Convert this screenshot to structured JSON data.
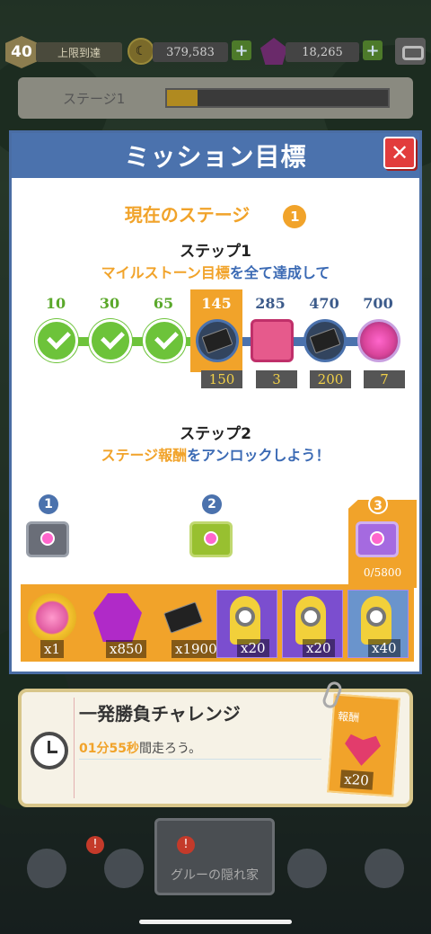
{
  "hud": {
    "level": "40",
    "level_status": "上限到達",
    "coins": "379,583",
    "gems": "18,265"
  },
  "stage_bar": {
    "label": "ステージ1"
  },
  "modal": {
    "title": "ミッション目標",
    "close_icon": "close-icon",
    "current_stage_label": "現在のステージ",
    "current_stage_number": "1",
    "step1": {
      "title": "ステップ1",
      "desc_highlight": "マイルストーン目標",
      "desc_rest": "を全て達成して"
    },
    "milestones": [
      {
        "value": "10",
        "state": "done"
      },
      {
        "value": "30",
        "state": "done"
      },
      {
        "value": "65",
        "state": "done"
      },
      {
        "value": "145",
        "state": "current",
        "reward_count": "150",
        "reward_icon": "ticket-icon"
      },
      {
        "value": "285",
        "state": "locked",
        "reward_count": "3",
        "reward_icon": "pink-box-icon"
      },
      {
        "value": "470",
        "state": "locked",
        "reward_count": "200",
        "reward_icon": "ticket-icon"
      },
      {
        "value": "700",
        "state": "locked",
        "reward_count": "7",
        "reward_icon": "medal-icon"
      }
    ],
    "step2": {
      "title": "ステップ2",
      "desc_highlight": "ステージ報酬",
      "desc_rest": "をアンロックしよう！"
    },
    "chests": [
      {
        "number": "1",
        "color": "grey"
      },
      {
        "number": "2",
        "color": "green"
      },
      {
        "number": "3",
        "color": "purple",
        "progress": "0/5800"
      }
    ],
    "rewards": [
      {
        "icon": "gold-medal-icon",
        "count": "x1"
      },
      {
        "icon": "purple-tokens-icon",
        "count": "x850"
      },
      {
        "icon": "ticket-icon",
        "count": "x1900"
      },
      {
        "icon": "minion-costume-card",
        "count": "x20"
      },
      {
        "icon": "minion-headphones-card",
        "count": "x20"
      },
      {
        "icon": "minion-beret-card",
        "count": "x40"
      }
    ]
  },
  "challenge": {
    "title": "一発勝負チャレンジ",
    "desc_num": "01分55秒",
    "desc_rest": "間走ろう。",
    "reward_label": "報酬",
    "reward_count": "x20"
  },
  "bottom_nav": {
    "center_label": "グルーの隠れ家",
    "badges": [
      "!",
      "!"
    ]
  },
  "colors": {
    "accent_orange": "#f1a32a",
    "header_blue": "#4b72ad",
    "check_green": "#6dc33a",
    "close_red": "#e23c3c"
  }
}
